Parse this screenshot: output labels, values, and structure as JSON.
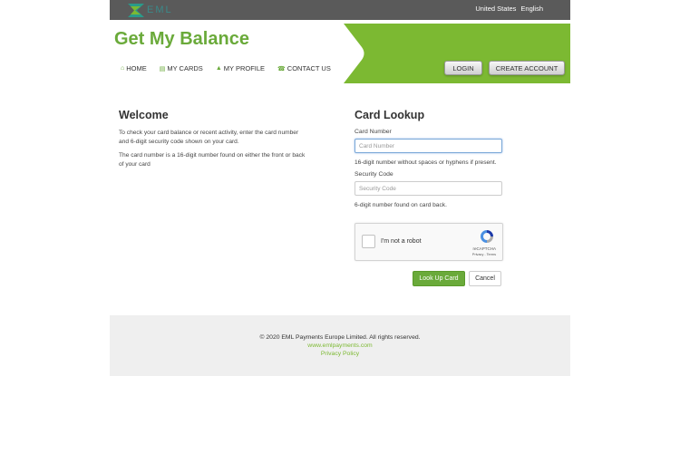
{
  "topbar": {
    "logo_text": "EML",
    "region": "United States",
    "language": "English"
  },
  "header": {
    "title": "Get My Balance",
    "nav": [
      {
        "label": "HOME",
        "icon": "home-icon",
        "glyph": "⌂"
      },
      {
        "label": "MY CARDS",
        "icon": "card-icon",
        "glyph": "▤"
      },
      {
        "label": "MY PROFILE",
        "icon": "user-icon",
        "glyph": "▲"
      },
      {
        "label": "CONTACT US",
        "icon": "phone-icon",
        "glyph": "☎"
      }
    ],
    "login_label": "LOGIN",
    "create_label": "CREATE ACCOUNT"
  },
  "welcome": {
    "heading": "Welcome",
    "para1": "To check your card balance or recent activity, enter the card number and 6-digit security code shown on your card.",
    "para2": "The card number is a 16-digit number found on either the front or back of your card"
  },
  "lookup": {
    "heading": "Card Lookup",
    "card_label": "Card Number",
    "card_placeholder": "Card Number",
    "card_hint": "16-digit number without spaces or hyphens if present.",
    "code_label": "Security Code",
    "code_placeholder": "Security Code",
    "code_hint": "6-digit number found on card back.",
    "captcha_text": "I'm not a robot",
    "captcha_brand": "reCAPTCHA",
    "captcha_links": "Privacy - Terms",
    "submit_label": "Look Up Card",
    "cancel_label": "Cancel"
  },
  "footer": {
    "copyright": "© 2020 EML Payments Europe Limited. All rights reserved.",
    "website": "www.emlpayments.com",
    "privacy": "Privacy Policy"
  },
  "colors": {
    "brand_green": "#7cb932",
    "title_green": "#6aaa3a",
    "topbar": "#5a5a5a"
  }
}
